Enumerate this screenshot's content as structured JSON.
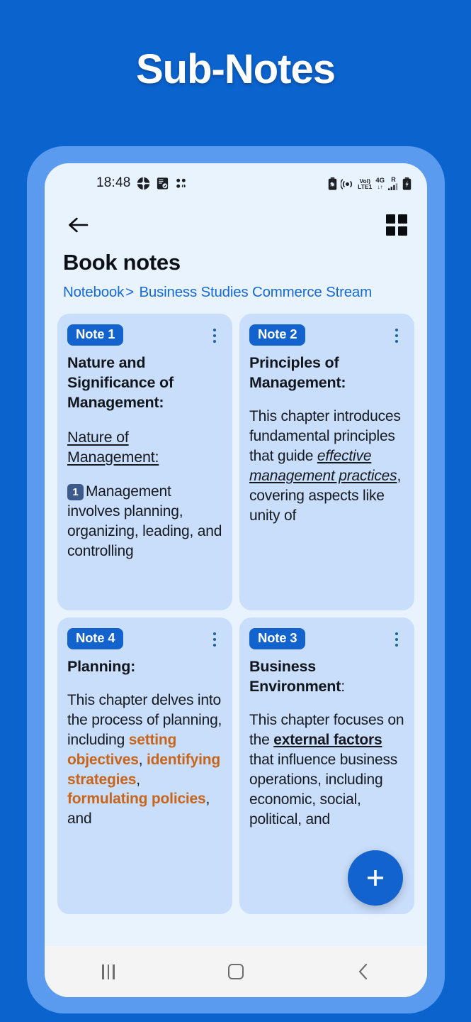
{
  "banner": {
    "title": "Sub-Notes"
  },
  "status_bar": {
    "time": "18:48",
    "left_icons": [
      "badminton-app-icon",
      "note-app-icon",
      "dots-app-icon"
    ],
    "right_icons": [
      "battery-saver-icon",
      "hotspot-icon",
      "volte-lte1-icon",
      "4g-data-icon",
      "roaming-signal-icon",
      "battery-icon"
    ],
    "network_volte": "VoI)",
    "network_lte": "LTE1",
    "network_4g": "4G",
    "network_roaming": "R"
  },
  "app_bar": {
    "back_icon": "arrow-left-icon",
    "grid_icon": "grid-view-icon"
  },
  "header": {
    "page_title": "Book notes",
    "breadcrumb_root": "Notebook",
    "breadcrumb_sep": ">",
    "breadcrumb_current": "Business Studies Commerce Stream"
  },
  "notes": [
    {
      "badge": "Note 1",
      "title": "Nature and Significance of Management:",
      "subheading": "Nature of Management:",
      "keycap": "1",
      "body_after_keycap": "Management involves planning, organizing, leading, and controlling",
      "menu_icon": "kebab-menu-icon"
    },
    {
      "badge": "Note 2",
      "title": "Principles of Management:",
      "body_pre": "This chapter introduces fundamental principles that guide ",
      "body_emphasis": "effective management practices",
      "body_post": ", covering aspects like unity of",
      "menu_icon": "kebab-menu-icon"
    },
    {
      "badge": "Note 4",
      "title": "Planning:",
      "body_pre": "This chapter delves into the process of planning, including ",
      "body_highlight_1": "setting objectives",
      "body_mid_1": ", ",
      "body_highlight_2": "identifying strategies",
      "body_mid_2": ", ",
      "body_highlight_3": "formulating policies",
      "body_post": ", and",
      "menu_icon": "kebab-menu-icon"
    },
    {
      "badge": "Note 3",
      "title_strong": "Business Environment",
      "title_colon": ":",
      "body_pre": "This chapter focuses on the ",
      "body_emphasis": "external factors",
      "body_post": " that influence business operations, including economic, social, political, and",
      "menu_icon": "kebab-menu-icon"
    }
  ],
  "fab": {
    "icon": "plus-icon",
    "label": "+"
  },
  "nav_bar": {
    "recents_icon": "recents-icon",
    "home_icon": "home-icon",
    "back_icon": "back-chevron-icon"
  },
  "colors": {
    "page_background": "#0B63CE",
    "phone_frame": "#5A9BF0",
    "screen_background": "#E8F3FD",
    "card_background": "#C9DEFB",
    "accent_blue": "#1263CE",
    "breadcrumb_blue": "#1769D6",
    "highlight_orange": "#C8651A",
    "nav_bar": "#F4F4F4"
  }
}
